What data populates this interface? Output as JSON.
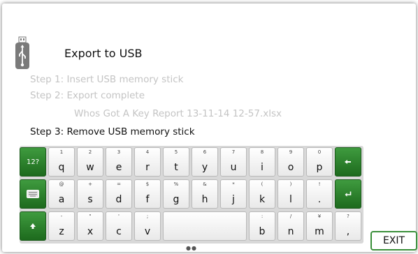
{
  "header": {
    "title": "Export to USB",
    "icon": "usb-icon"
  },
  "steps": {
    "step1": "Step 1: Insert USB memory stick",
    "step2": "Step 2: Export complete",
    "filename": "Whos Got A Key Report 13-11-14 12-57.xlsx",
    "step3": "Step 3: Remove USB memory stick"
  },
  "keyboard": {
    "mode_key": "12?",
    "row1": [
      {
        "sub": "1",
        "main": "q"
      },
      {
        "sub": "2",
        "main": "w"
      },
      {
        "sub": "3",
        "main": "e"
      },
      {
        "sub": "4",
        "main": "r"
      },
      {
        "sub": "5",
        "main": "t"
      },
      {
        "sub": "6",
        "main": "y"
      },
      {
        "sub": "7",
        "main": "u"
      },
      {
        "sub": "8",
        "main": "i"
      },
      {
        "sub": "9",
        "main": "o"
      },
      {
        "sub": "0",
        "main": "p"
      }
    ],
    "row2": [
      {
        "sub": "@",
        "main": "a"
      },
      {
        "sub": "+",
        "main": "s"
      },
      {
        "sub": "=",
        "main": "d"
      },
      {
        "sub": "$",
        "main": "f"
      },
      {
        "sub": "%",
        "main": "g"
      },
      {
        "sub": "&",
        "main": "h"
      },
      {
        "sub": "*",
        "main": "j"
      },
      {
        "sub": "(",
        "main": "k"
      },
      {
        "sub": ")",
        "main": "l"
      },
      {
        "sub": "!",
        "main": "."
      }
    ],
    "row3_left": [
      {
        "sub": "-",
        "main": "z"
      },
      {
        "sub": "\"",
        "main": "x"
      },
      {
        "sub": "'",
        "main": "c"
      },
      {
        "sub": ";",
        "main": "v"
      }
    ],
    "row3_right": [
      {
        "sub": ":",
        "main": "b"
      },
      {
        "sub": "/",
        "main": "n"
      },
      {
        "sub": "¥",
        "main": "m"
      },
      {
        "sub": "?",
        "main": ","
      }
    ]
  },
  "pager": {
    "dots": "●●"
  },
  "exit_label": "EXIT",
  "colors": {
    "accent": "#2e8b2e",
    "disabled_text": "#c4c4c4"
  }
}
